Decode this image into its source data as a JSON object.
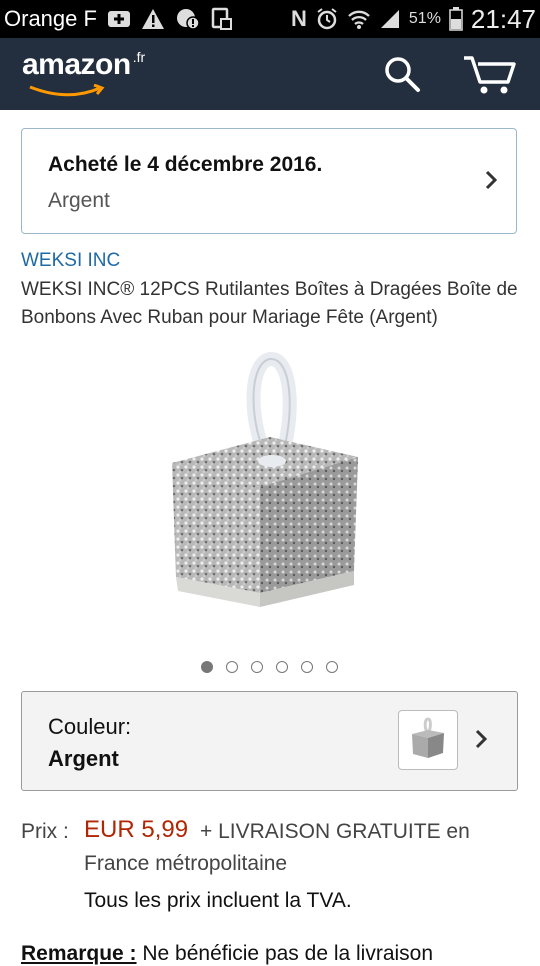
{
  "status_bar": {
    "carrier": "Orange F",
    "network": "N",
    "battery": "51%",
    "time": "21:47"
  },
  "header": {
    "logo_main": "amazon",
    "logo_tld": ".fr",
    "search_icon": "search-icon",
    "cart_icon": "cart-icon"
  },
  "order": {
    "date_label": "Acheté le 4 décembre 2016.",
    "variant": "Argent"
  },
  "product": {
    "brand": "WEKSI INC",
    "title": "WEKSI INC® 12PCS Rutilantes Boîtes à Dragées Boîte de Bonbons Avec Ruban pour Mariage Fête (Argent)",
    "image_count": 6,
    "active_image": 1
  },
  "color_selector": {
    "label": "Couleur:",
    "value": "Argent"
  },
  "pricing": {
    "label": "Prix :",
    "price": "EUR 5,99",
    "shipping_line1": "+ LIVRAISON GRATUITE en",
    "shipping_line2": "France métropolitaine",
    "tax_note": "Tous les prix incluent la TVA."
  },
  "remark": {
    "label": "Remarque :",
    "text": " Ne bénéficie pas de la livraison"
  },
  "colors": {
    "header_bg": "#232f3e",
    "price": "#b12704",
    "brand_link": "#1f6aa5",
    "smile": "#f90"
  }
}
